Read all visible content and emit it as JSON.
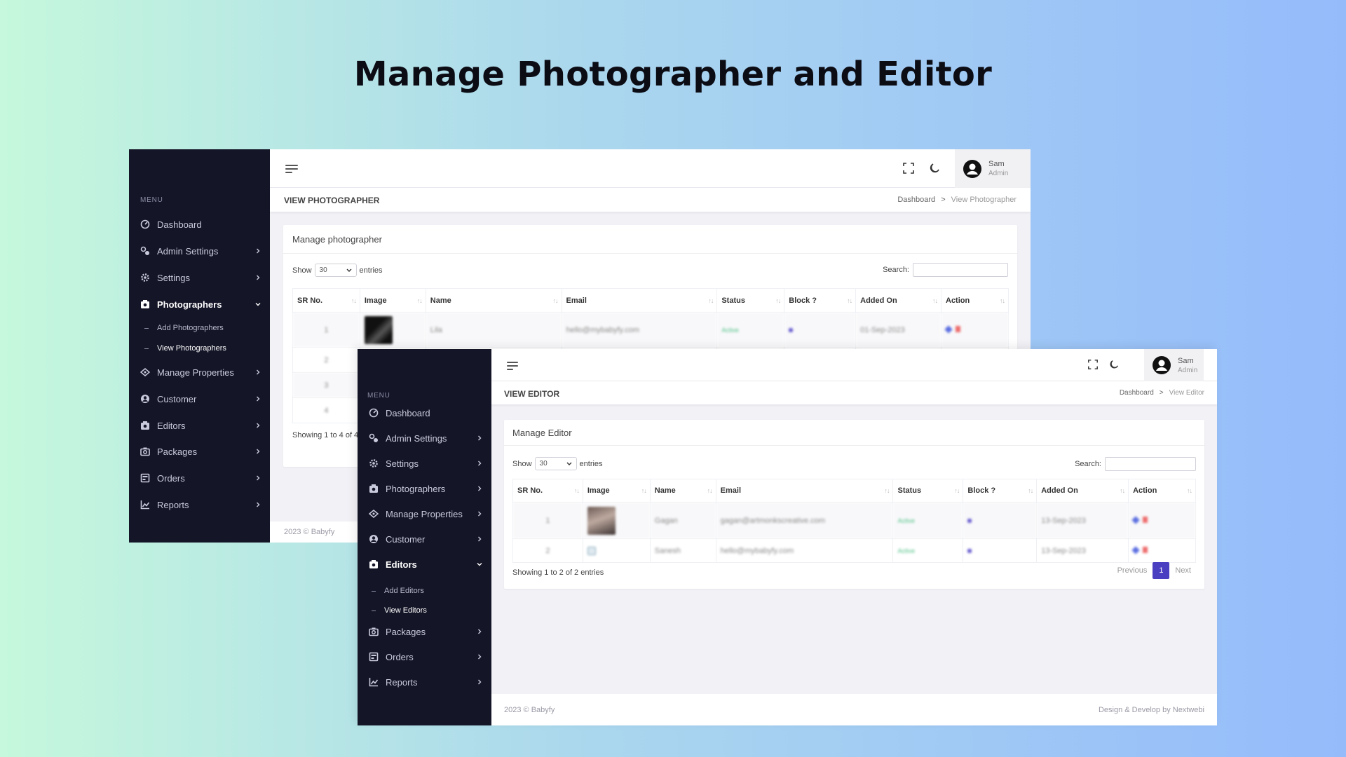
{
  "headline": "Manage Photographer and Editor",
  "photographer_window": {
    "menu_caption": "MENU",
    "nav": [
      {
        "label": "Dashboard",
        "icon": "dashboard-icon",
        "chevron": false
      },
      {
        "label": "Admin Settings",
        "icon": "admin-settings-icon",
        "chevron": true
      },
      {
        "label": "Settings",
        "icon": "gear-icon",
        "chevron": true
      },
      {
        "label": "Photographers",
        "icon": "photographer-icon",
        "chevron": true,
        "expanded": true
      },
      {
        "label": "Manage Properties",
        "icon": "properties-icon",
        "chevron": true
      },
      {
        "label": "Customer",
        "icon": "customer-icon",
        "chevron": true
      },
      {
        "label": "Editors",
        "icon": "editor-icon",
        "chevron": true
      },
      {
        "label": "Packages",
        "icon": "camera-icon",
        "chevron": true
      },
      {
        "label": "Orders",
        "icon": "orders-icon",
        "chevron": true
      },
      {
        "label": "Reports",
        "icon": "reports-icon",
        "chevron": true
      }
    ],
    "subnav": [
      "Add Photographers",
      "View Photographers"
    ],
    "user": {
      "name": "Sam",
      "role": "Admin"
    },
    "page_title": "VIEW PHOTOGRAPHER",
    "breadcrumb": {
      "home": "Dashboard",
      "sep": ">",
      "current": "View Photographer"
    },
    "card_title": "Manage photographer",
    "show_label": "Show",
    "show_value": "30",
    "entries_label": "entries",
    "search_label": "Search:",
    "columns": [
      "SR No.",
      "Image",
      "Name",
      "Email",
      "Status",
      "Block ?",
      "Added On",
      "Action"
    ],
    "rows": [
      {
        "sr": "1",
        "name": "Lila",
        "email": "hello@mybabyfy.com",
        "status": "Active",
        "added": "01-Sep-2023"
      },
      {
        "sr": "2"
      },
      {
        "sr": "3"
      },
      {
        "sr": "4"
      }
    ],
    "info": "Showing 1 to 4 of 4",
    "footer": "2023 © Babyfy"
  },
  "editor_window": {
    "menu_caption": "MENU",
    "nav": [
      {
        "label": "Dashboard",
        "icon": "dashboard-icon",
        "chevron": false
      },
      {
        "label": "Admin Settings",
        "icon": "admin-settings-icon",
        "chevron": true
      },
      {
        "label": "Settings",
        "icon": "gear-icon",
        "chevron": true
      },
      {
        "label": "Photographers",
        "icon": "photographer-icon",
        "chevron": true
      },
      {
        "label": "Manage Properties",
        "icon": "properties-icon",
        "chevron": true
      },
      {
        "label": "Customer",
        "icon": "customer-icon",
        "chevron": true
      },
      {
        "label": "Editors",
        "icon": "editor-icon",
        "chevron": true,
        "expanded": true
      },
      {
        "label": "Packages",
        "icon": "camera-icon",
        "chevron": true
      },
      {
        "label": "Orders",
        "icon": "orders-icon",
        "chevron": true
      },
      {
        "label": "Reports",
        "icon": "reports-icon",
        "chevron": true
      }
    ],
    "subnav": [
      "Add Editors",
      "View Editors"
    ],
    "user": {
      "name": "Sam",
      "role": "Admin"
    },
    "page_title": "VIEW EDITOR",
    "breadcrumb": {
      "home": "Dashboard",
      "sep": ">",
      "current": "View Editor"
    },
    "card_title": "Manage Editor",
    "show_label": "Show",
    "show_value": "30",
    "entries_label": "entries",
    "search_label": "Search:",
    "columns": [
      "SR No.",
      "Image",
      "Name",
      "Email",
      "Status",
      "Block ?",
      "Added On",
      "Action"
    ],
    "rows": [
      {
        "sr": "1",
        "name": "Gagan",
        "email": "gagan@artmonkscreative.com",
        "status": "Active",
        "added": "13-Sep-2023"
      },
      {
        "sr": "2",
        "name": "Sanesh",
        "email": "hello@mybabyfy.com",
        "status": "Active",
        "added": "13-Sep-2023"
      }
    ],
    "info": "Showing 1 to 2 of 2 entries",
    "pager": {
      "prev": "Previous",
      "page": "1",
      "next": "Next"
    },
    "footer_left": "2023 © Babyfy",
    "footer_right": "Design & Develop by Nextwebi"
  },
  "colors": {
    "sidebar": "#141527",
    "accent": "#4b3fc1",
    "status_active": "#4cc084",
    "delete": "#ee6b6b"
  }
}
